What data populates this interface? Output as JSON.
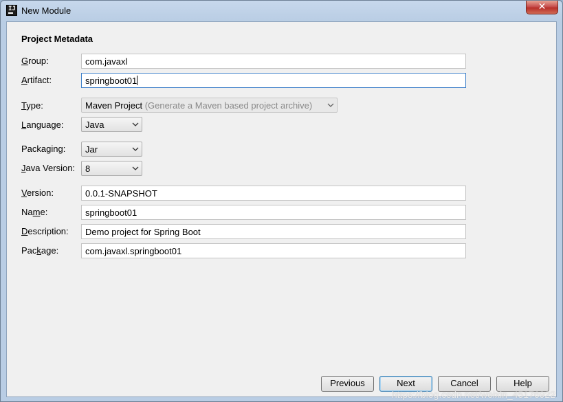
{
  "window": {
    "title": "New Module",
    "app_icon_text": "IJ",
    "close_label": "✕"
  },
  "section_title": "Project Metadata",
  "fields": {
    "group": {
      "label_pre": "",
      "label_key": "G",
      "label_post": "roup:",
      "value": "com.javaxl"
    },
    "artifact": {
      "label_pre": "",
      "label_key": "A",
      "label_post": "rtifact:",
      "value": "springboot01"
    },
    "version": {
      "label_pre": "",
      "label_key": "V",
      "label_post": "ersion:",
      "value": "0.0.1-SNAPSHOT"
    },
    "name": {
      "label_pre": "Na",
      "label_key": "m",
      "label_post": "e:",
      "value": "springboot01"
    },
    "description": {
      "label_pre": "",
      "label_key": "D",
      "label_post": "escription:",
      "value": "Demo project for Spring Boot"
    },
    "package": {
      "label_pre": "Pac",
      "label_key": "k",
      "label_post": "age:",
      "value": "com.javaxl.springboot01"
    }
  },
  "combos": {
    "type": {
      "label_pre": "",
      "label_key": "T",
      "label_post": "ype:",
      "value": "Maven Project",
      "hint": "(Generate a Maven based project archive)"
    },
    "language": {
      "label_pre": "",
      "label_key": "L",
      "label_post": "anguage:",
      "value": "Java"
    },
    "packaging": {
      "label_pre": "Packa",
      "label_key": "g",
      "label_post": "ing:",
      "value": "Jar"
    },
    "java_version": {
      "label_pre": "",
      "label_key": "J",
      "label_post": "ava Version:",
      "value": "8"
    }
  },
  "buttons": {
    "previous": "Previous",
    "next": "Next",
    "cancel": "Cancel",
    "help": "Help"
  },
  "watermark": "https://blog.csdn.net/weixin_45176922"
}
